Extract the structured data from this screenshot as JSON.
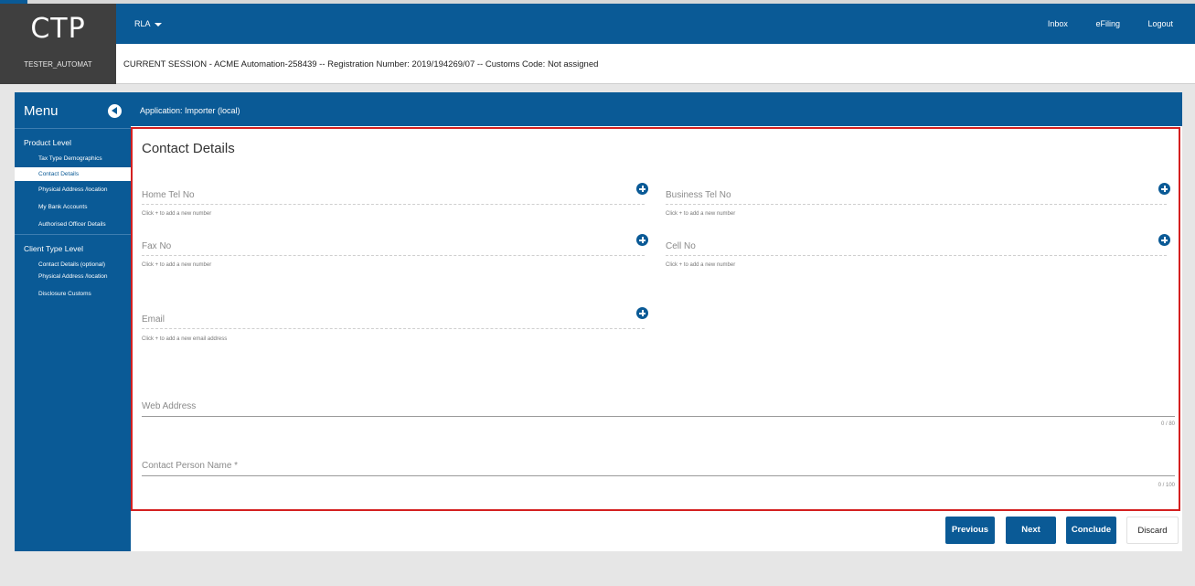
{
  "header": {
    "app_title": "CTP",
    "username": "TESTER_AUTOMAT",
    "role_menu": "RLA",
    "links": [
      "Inbox",
      "eFiling",
      "Logout"
    ],
    "session_text": "CURRENT SESSION - ACME Automation-258439 -- Registration Number: 2019/194269/07 -- Customs Code: Not assigned"
  },
  "sidebar": {
    "menu_label": "Menu",
    "section1": "Product Level",
    "section1_items": [
      "Tax Type Demographics",
      "Contact Details",
      "Physical Address /location",
      "My Bank Accounts",
      "Authorised Officer Details"
    ],
    "active_item": "Contact Details",
    "section2": "Client Type Level",
    "section2_items": [
      "Contact Details (optional)",
      "Physical Address /location",
      "Disclosure Customs"
    ]
  },
  "app_bar": {
    "text": "Application: Importer (local)"
  },
  "form": {
    "title": "Contact Details",
    "home_tel": {
      "placeholder": "Home Tel No",
      "hint": "Click + to add a new number"
    },
    "business_tel": {
      "placeholder": "Business Tel No",
      "hint": "Click + to add a new number"
    },
    "fax": {
      "placeholder": "Fax No",
      "hint": "Click + to add a new number"
    },
    "cell": {
      "placeholder": "Cell No",
      "hint": "Click + to add a new number"
    },
    "email": {
      "placeholder": "Email",
      "hint": "Click + to add a new email address"
    },
    "web": {
      "placeholder": "Web Address",
      "counter": "0 / 80"
    },
    "contact_person": {
      "placeholder": "Contact Person Name *",
      "counter": "0 / 100"
    }
  },
  "buttons": {
    "previous": "Previous",
    "next": "Next",
    "conclude": "Conclude",
    "discard": "Discard"
  },
  "colors": {
    "primary": "#0a5a96",
    "highlight_border": "#d42020",
    "logo_bg": "#3f3f3f"
  }
}
